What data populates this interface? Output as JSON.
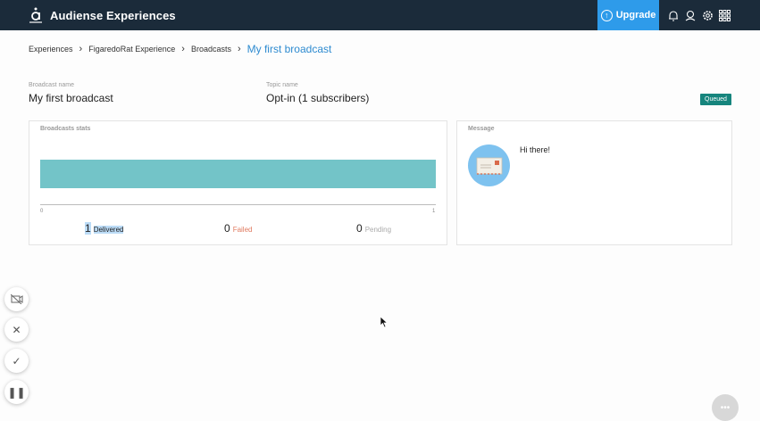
{
  "app": {
    "title": "Audiense Experiences",
    "upgrade_label": "Upgrade",
    "icons": [
      "bell-icon",
      "user-icon",
      "gear-icon",
      "apps-grid-icon"
    ]
  },
  "breadcrumb": {
    "items": [
      "Experiences",
      "FigaredoRat Experience",
      "Broadcasts"
    ],
    "current": "My first broadcast"
  },
  "broadcast": {
    "name_label": "Broadcast name",
    "name": "My first broadcast",
    "topic_label": "Topic name",
    "topic": "Opt-in (1 subscribers)",
    "status": "Queued"
  },
  "stats": {
    "title": "Broadcasts stats",
    "axis_min": "0",
    "axis_max": "1",
    "delivered": {
      "count": "1",
      "label": "Delivered"
    },
    "failed": {
      "count": "0",
      "label": "Failed"
    },
    "pending": {
      "count": "0",
      "label": "Pending"
    }
  },
  "message": {
    "title": "Message",
    "text": "Hi there!"
  },
  "chart_data": {
    "type": "bar",
    "categories": [
      "Delivered"
    ],
    "values": [
      1
    ],
    "xlim": [
      0,
      1
    ],
    "title": "Broadcasts stats"
  },
  "colors": {
    "topbar": "#1b2b3a",
    "upgrade": "#2e9bea",
    "bar": "#73c4c8",
    "badge": "#16857d"
  }
}
